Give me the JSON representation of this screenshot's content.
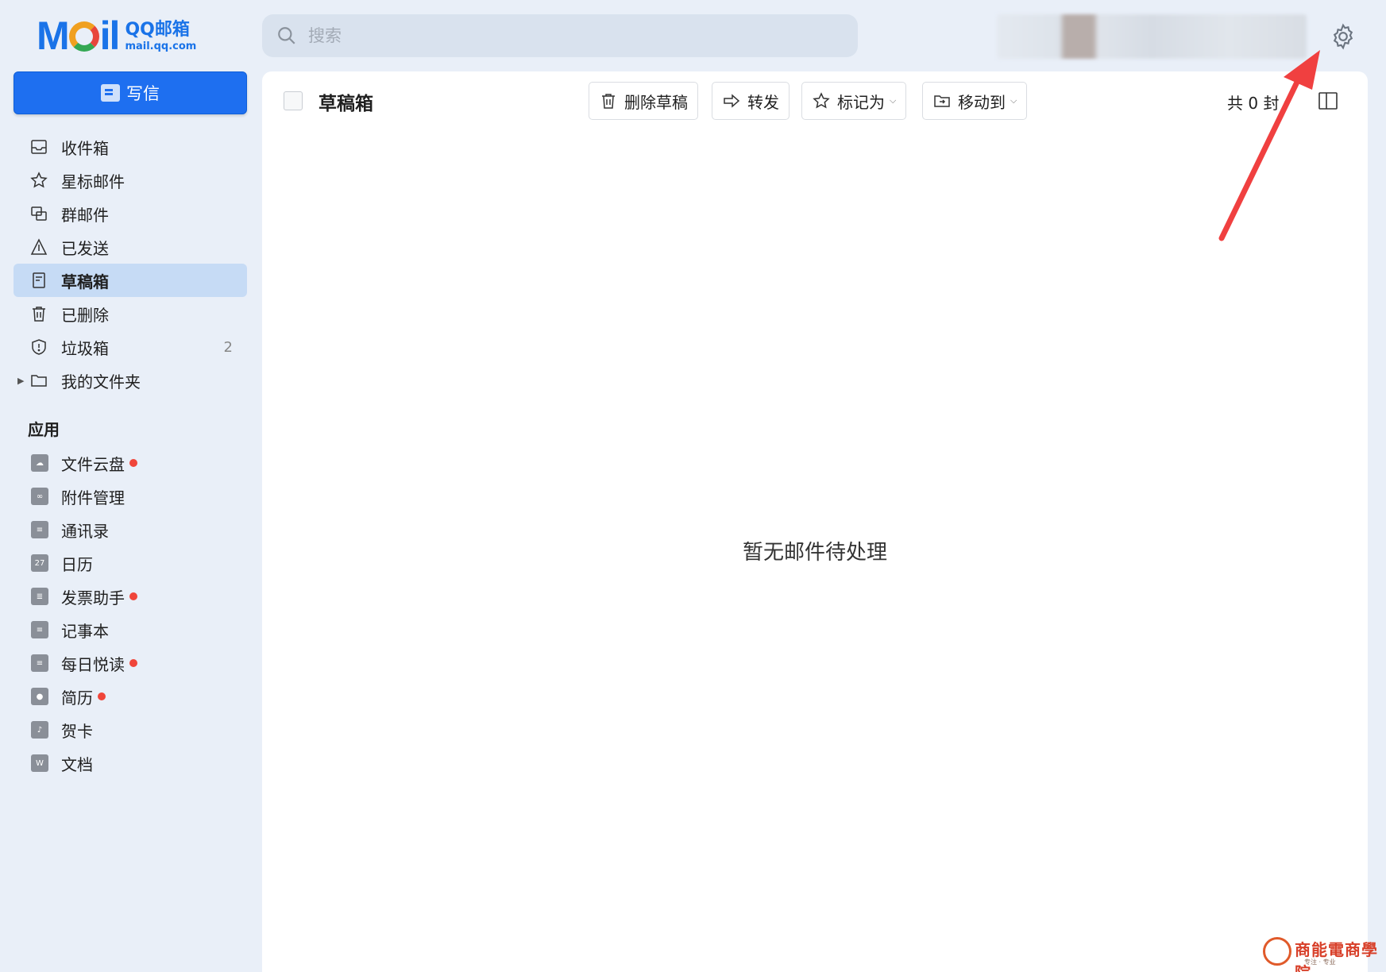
{
  "logo": {
    "mark_left": "M",
    "mark_right": "il",
    "title": "QQ邮箱",
    "subtitle": "mail.qq.com"
  },
  "search": {
    "placeholder": "搜索"
  },
  "compose": {
    "label": "写信"
  },
  "nav": [
    {
      "label": "收件箱",
      "icon": "inbox-icon"
    },
    {
      "label": "星标邮件",
      "icon": "star-icon"
    },
    {
      "label": "群邮件",
      "icon": "group-mail-icon"
    },
    {
      "label": "已发送",
      "icon": "sent-icon"
    },
    {
      "label": "草稿箱",
      "icon": "drafts-icon",
      "active": true
    },
    {
      "label": "已删除",
      "icon": "trash-icon"
    },
    {
      "label": "垃圾箱",
      "icon": "spam-shield-icon",
      "count": "2"
    },
    {
      "label": "我的文件夹",
      "icon": "folder-icon"
    }
  ],
  "apps": {
    "title": "应用",
    "items": [
      {
        "label": "文件云盘",
        "dot": true
      },
      {
        "label": "附件管理",
        "dot": false
      },
      {
        "label": "通讯录",
        "dot": false
      },
      {
        "label": "日历",
        "dot": false,
        "icon_text": "27"
      },
      {
        "label": "发票助手",
        "dot": true
      },
      {
        "label": "记事本",
        "dot": false
      },
      {
        "label": "每日悦读",
        "dot": true
      },
      {
        "label": "简历",
        "dot": true
      },
      {
        "label": "贺卡",
        "dot": false
      },
      {
        "label": "文档",
        "dot": false,
        "icon_text": "W"
      }
    ]
  },
  "main": {
    "folder_title": "草稿箱",
    "toolbar": {
      "delete_draft": "删除草稿",
      "forward": "转发",
      "mark_as": "标记为",
      "move_to": "移动到"
    },
    "total": "共 0 封",
    "empty_message": "暂无邮件待处理"
  },
  "watermark": {
    "text": "商能電商學院",
    "sub": "专注 · 专业"
  },
  "colors": {
    "accent": "#1e6ff0",
    "annotation_arrow": "#f04040",
    "unread_dot": "#f0453a"
  }
}
